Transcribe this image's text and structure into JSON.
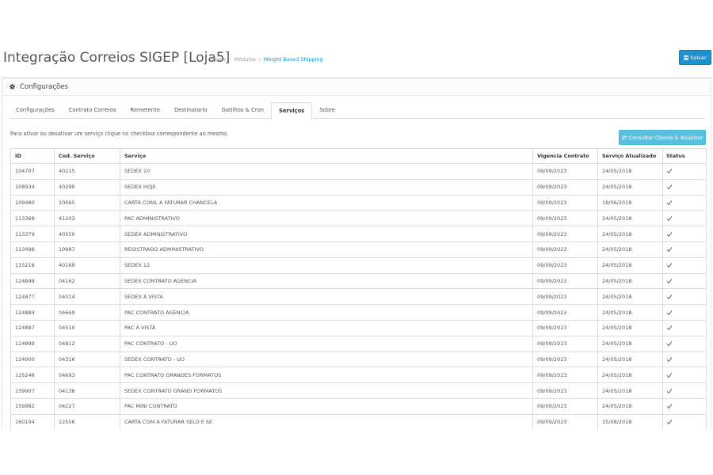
{
  "header": {
    "title": "Integração Correios SIGEP [Loja5]",
    "breadcrumb": [
      "Home",
      "Módulos",
      "Weight Based Shipping"
    ],
    "save_label": "Salvar"
  },
  "panel": {
    "title": "Configurações",
    "tabs": [
      {
        "label": "Configurações",
        "active": false
      },
      {
        "label": "Contrato Correios",
        "active": false
      },
      {
        "label": "Remetente",
        "active": false
      },
      {
        "label": "Destinatario",
        "active": false
      },
      {
        "label": "Gatilhos & Cron",
        "active": false
      },
      {
        "label": "Serviços",
        "active": true
      },
      {
        "label": "Sobre",
        "active": false
      }
    ],
    "help_text": "Para ativar ou desativar um serviço clique no checkbox correspondente ao mesmo.",
    "consult_label": "Consultar Cliente & Atualizar"
  },
  "table": {
    "columns": [
      "ID",
      "Cod. Serviço",
      "Serviço",
      "Vigencia Contrato",
      "Serviço Atualizado",
      "Status"
    ],
    "rows": [
      [
        "104707",
        "40215",
        "SEDEX 10",
        "09/09/2023",
        "24/05/2018"
      ],
      [
        "108934",
        "40290",
        "SEDEX HOJE",
        "09/09/2023",
        "24/05/2018"
      ],
      [
        "109480",
        "10065",
        "CARTA COML A FATURAR CHANCELA",
        "09/09/2023",
        "19/06/2018"
      ],
      [
        "113368",
        "41203",
        "PAC ADMINISTRATIVO",
        "09/09/2023",
        "24/05/2018"
      ],
      [
        "113379",
        "40550",
        "SEDEX ADMINISTRATIVO",
        "09/09/2023",
        "24/05/2018"
      ],
      [
        "113498",
        "10987",
        "REGISTRADO ADMINISTRATIVO",
        "09/09/2023",
        "24/05/2018"
      ],
      [
        "115218",
        "40169",
        "SEDEX 12",
        "09/09/2023",
        "24/05/2018"
      ],
      [
        "124849",
        "04162",
        "SEDEX CONTRATO AGENCIA",
        "09/09/2023",
        "24/05/2018"
      ],
      [
        "124877",
        "04014",
        "SEDEX A VISTA",
        "09/09/2023",
        "24/05/2018"
      ],
      [
        "124884",
        "04669",
        "PAC CONTRATO AGENCIA",
        "09/09/2023",
        "24/05/2018"
      ],
      [
        "124887",
        "04510",
        "PAC A VISTA",
        "09/09/2023",
        "24/05/2018"
      ],
      [
        "124899",
        "04812",
        "PAC CONTRATO - UO",
        "09/09/2023",
        "24/05/2018"
      ],
      [
        "124900",
        "04316",
        "SEDEX CONTRATO - UO",
        "09/09/2023",
        "24/05/2018"
      ],
      [
        "125248",
        "04693",
        "PAC CONTRATO GRANDES FORMATOS",
        "09/09/2023",
        "24/05/2018"
      ],
      [
        "159907",
        "04138",
        "SEDEX CONTRATO GRAND FORMATOS",
        "09/09/2023",
        "24/05/2018"
      ],
      [
        "159982",
        "04227",
        "PAC MINI CONTRATO",
        "09/09/2023",
        "24/05/2018"
      ],
      [
        "160104",
        "12556",
        "CARTA COM A FATURAR SELO E SE",
        "09/09/2023",
        "15/08/2018"
      ]
    ],
    "status_checked": [
      true,
      true,
      true,
      true,
      true,
      true,
      true,
      true,
      true,
      true,
      true,
      true,
      true,
      true,
      true,
      true,
      true
    ]
  },
  "icons": {
    "save": "floppy-icon",
    "settings": "gear-icon",
    "refresh": "refresh-icon",
    "status": "check-icon"
  },
  "colors": {
    "primary": "#1e91cf",
    "info": "#5bc0de"
  }
}
